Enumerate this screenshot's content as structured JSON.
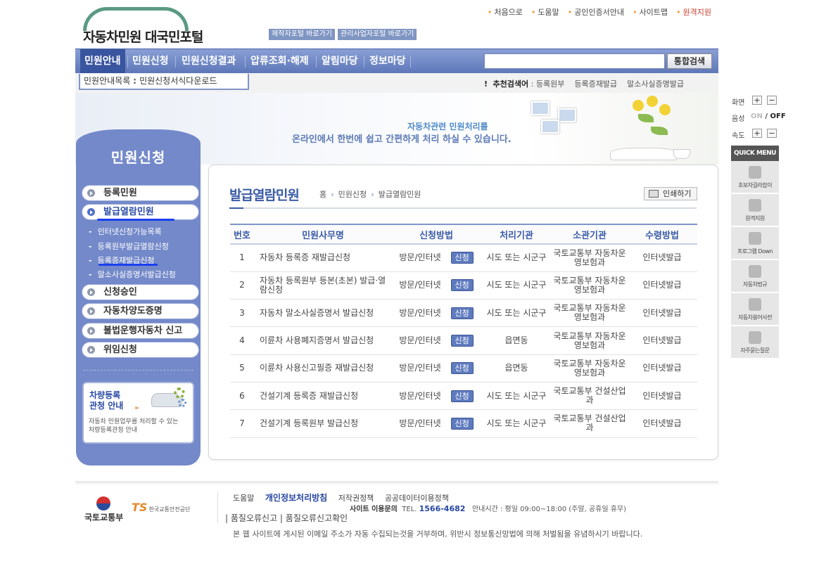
{
  "site": {
    "logo_text": "자동차민원 대국민포털",
    "portal_links": [
      "제작자포털 바로가기",
      "관리사업자포털 바로가기"
    ],
    "top_links": [
      "처음으로",
      "도움말",
      "공인인증서안내",
      "사이트맵",
      "원격지원"
    ]
  },
  "gnb": {
    "items": [
      "민원안내",
      "민원신청",
      "민원신청결과",
      "압류조회·해제",
      "알림마당",
      "정보마당"
    ],
    "search_placeholder": "",
    "search_button": "통합검색",
    "sub_nav": [
      "민원안내목록",
      "민원신청서식다운로드"
    ],
    "recommend_label": "추천검색어",
    "recommend_terms": [
      "등록원부",
      "등록증재발급",
      "말소사실증명발급"
    ]
  },
  "banner": {
    "line1": "자동차관련 민원처리를",
    "line2": "온라인에서 한번에 쉽고 간편하게 처리 하실 수 있습니다."
  },
  "sidebar": {
    "title": "민원신청",
    "items": [
      "등록민원",
      "발급열람민원",
      "신청승인",
      "자동차양도증명",
      "불법운행자동차 신고",
      "위임신청"
    ],
    "subitems": [
      "인터넷신청가능목록",
      "등록원부발급열람신청",
      "등록증재발급신청",
      "말소사실증명서발급신청"
    ],
    "box_title_1": "차량등록",
    "box_title_2": "관청 안내",
    "box_desc_1": "자동차 민원업무를 처리할 수 있는",
    "box_desc_2": "차량등록관청 안내"
  },
  "content": {
    "title": "발급열람민원",
    "breadcrumb": [
      "홈",
      "민원신청",
      "발급열람민원"
    ],
    "print_button": "인쇄하기",
    "columns": [
      "번호",
      "민원사무명",
      "신청방법",
      "처리기관",
      "소관기관",
      "수령방법"
    ],
    "apply_label": "신청",
    "rows": [
      {
        "no": "1",
        "name": "자동차 등록증 재발급신청",
        "method": "방문/인터넷",
        "agency": "시도 또는 시군구",
        "dept": "국토교통부 자동차운영보험과",
        "receive": "인터넷발급"
      },
      {
        "no": "2",
        "name": "자동차 등록원부 등본(초본) 발급·열람신청",
        "method": "방문/인터넷",
        "agency": "시도 또는 시군구",
        "dept": "국토교통부 자동차운영보험과",
        "receive": "인터넷발급"
      },
      {
        "no": "3",
        "name": "자동차 말소사실증명서 발급신청",
        "method": "방문/인터넷",
        "agency": "시도 또는 시군구",
        "dept": "국토교통부 자동차운영보험과",
        "receive": "인터넷발급"
      },
      {
        "no": "4",
        "name": "이륜차 사용폐지증명서 발급신청",
        "method": "방문/인터넷",
        "agency": "읍면동",
        "dept": "국토교통부 자동차운영보험과",
        "receive": "인터넷발급"
      },
      {
        "no": "5",
        "name": "이륜차 사용신고필증 재발급신청",
        "method": "방문/인터넷",
        "agency": "읍면동",
        "dept": "국토교통부 자동차운영보험과",
        "receive": "인터넷발급"
      },
      {
        "no": "6",
        "name": "건설기계 등록증 재발급신청",
        "method": "방문/인터넷",
        "agency": "시도 또는 시군구",
        "dept": "국토교통부 건설산업과",
        "receive": "인터넷발급"
      },
      {
        "no": "7",
        "name": "건설기계 등록원부 발급신청",
        "method": "방문/인터넷",
        "agency": "시도 또는 시군구",
        "dept": "국토교통부 건설산업과",
        "receive": "인터넷발급"
      }
    ]
  },
  "quick": {
    "screen_label": "화면",
    "voice_label": "음성",
    "voice_on": "ON",
    "voice_off": "OFF",
    "speed_label": "속도",
    "menu_title": "QUICK MENU",
    "items": [
      "초보자길라잡이",
      "원격지원",
      "프로그램 Down",
      "자동차법규",
      "자동차용어사전",
      "자주묻는질문"
    ]
  },
  "footer": {
    "logo1": "국토교통부",
    "logo2_mark": "TS",
    "logo2_name": "한국교통안전공단",
    "links": [
      "도움말",
      "개인정보처리방침",
      "저작권정책",
      "공공데이터이용정책"
    ],
    "contact_label": "사이트 이용문의",
    "tel_label": "TEL.",
    "tel": "1566-4682",
    "hours": "안내시간 : 평일 09:00~18:00 (주말, 공휴일 휴무)",
    "report_links": [
      "품질오류신고",
      "품질오류신고확인"
    ],
    "notice": "본 웹 사이트에 게시된 이메일 주소가 자동 수집되는것을 거부하며, 위반시 정보통신망법에 의해 처벌됨을 유념하시기 바랍니다."
  }
}
